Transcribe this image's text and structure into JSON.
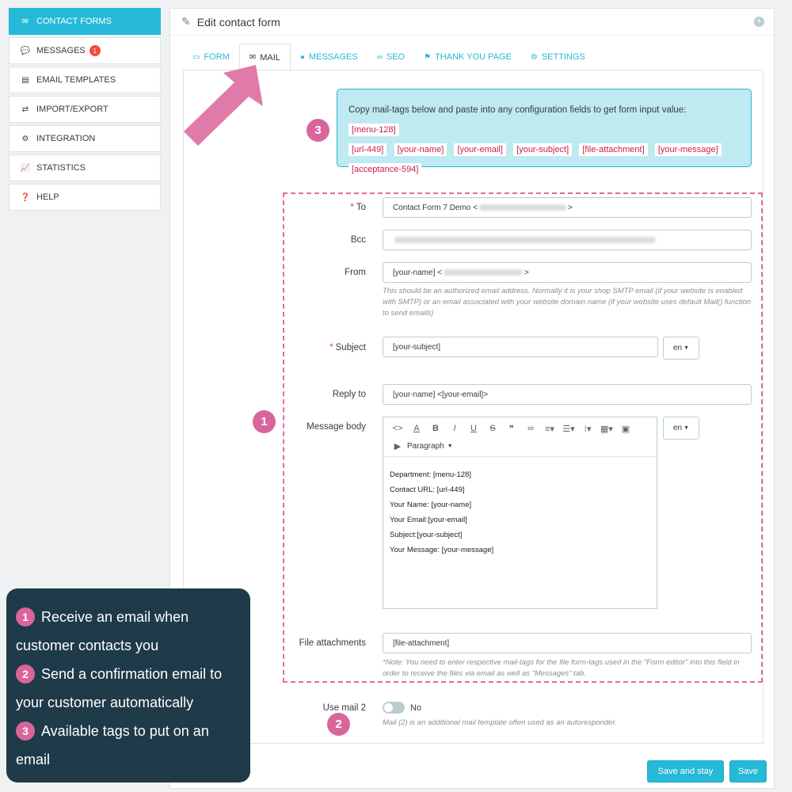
{
  "sidebar": {
    "items": [
      {
        "label": "CONTACT FORMS",
        "icon": "envelope-icon",
        "active": true
      },
      {
        "label": "MESSAGES",
        "icon": "comments-icon",
        "badge": "1"
      },
      {
        "label": "EMAIL TEMPLATES",
        "icon": "document-icon"
      },
      {
        "label": "IMPORT/EXPORT",
        "icon": "exchange-icon"
      },
      {
        "label": "INTEGRATION",
        "icon": "cogs-icon"
      },
      {
        "label": "STATISTICS",
        "icon": "line-chart-icon"
      },
      {
        "label": "HELP",
        "icon": "question-circle-icon"
      }
    ]
  },
  "panel": {
    "title": "Edit contact form",
    "tabs": [
      {
        "label": "FORM",
        "icon": "form-icon"
      },
      {
        "label": "MAIL",
        "icon": "envelope-icon",
        "active": true
      },
      {
        "label": "MESSAGES",
        "icon": "comments-icon"
      },
      {
        "label": "SEO",
        "icon": "link-icon"
      },
      {
        "label": "THANK YOU PAGE",
        "icon": "flag-icon"
      },
      {
        "label": "SETTINGS",
        "icon": "gear-icon"
      }
    ]
  },
  "mail_tags": {
    "intro": "Copy mail-tags below and paste into any configuration fields to get form input value:",
    "tags": [
      "[menu-128]",
      "[url-449]",
      "[your-name]",
      "[your-email]",
      "[your-subject]",
      "[file-attachment]",
      "[your-message]",
      "[acceptance-594]"
    ]
  },
  "form": {
    "to_label": "To",
    "to_value_prefix": "Contact Form 7 Demo <",
    "to_value_suffix": ">",
    "bcc_label": "Bcc",
    "from_label": "From",
    "from_value_prefix": "[your-name] <",
    "from_value_suffix": ">",
    "from_help": "This should be an authorized email address. Normally it is your shop SMTP email (if your website is enabled with SMTP) or an email associated with your website domain name (if your website uses default Mail() function to send emails)",
    "subject_label": "Subject",
    "subject_value": "[your-subject]",
    "lang": "en",
    "reply_label": "Reply to",
    "reply_value": "[your-name] <[your-email]>",
    "body_label": "Message body",
    "paragraph_label": "Paragraph",
    "body_lines": [
      "Department: [menu-128]",
      "Contact URL: [url-449]",
      "Your Name: [your-name]",
      "Your Email:[your-email]",
      "Subject:[your-subject]",
      "Your Message: [your-message]"
    ],
    "attach_label": "File attachments",
    "attach_value": "[file-attachment]",
    "attach_help": "*Note: You need to enter respective mail-tags for the file form-tags used in the \"Form editor\" into this field in order to receive the files via email as well as \"Messages\" tab.",
    "mail2_label": "Use mail 2",
    "mail2_state": "No",
    "mail2_help": "Mail (2) is an additional mail template often used as an autoresponder."
  },
  "buttons": {
    "save_stay": "Save and stay",
    "save": "Save"
  },
  "callouts": {
    "n1": "1",
    "n2": "2",
    "n3": "3"
  },
  "legend": {
    "items": [
      {
        "num": "1",
        "line1": "Receive an email when",
        "line2": "customer contacts you"
      },
      {
        "num": "2",
        "line1": "Send a confirmation email to",
        "line2": "your customer automatically"
      },
      {
        "num": "3",
        "line1": "Available tags to put on an",
        "line2": "email"
      }
    ]
  },
  "colors": {
    "accent": "#25b9d7",
    "callout": "#d9659a",
    "legend_bg": "#1f3a49",
    "tag_text": "#c8214d"
  }
}
